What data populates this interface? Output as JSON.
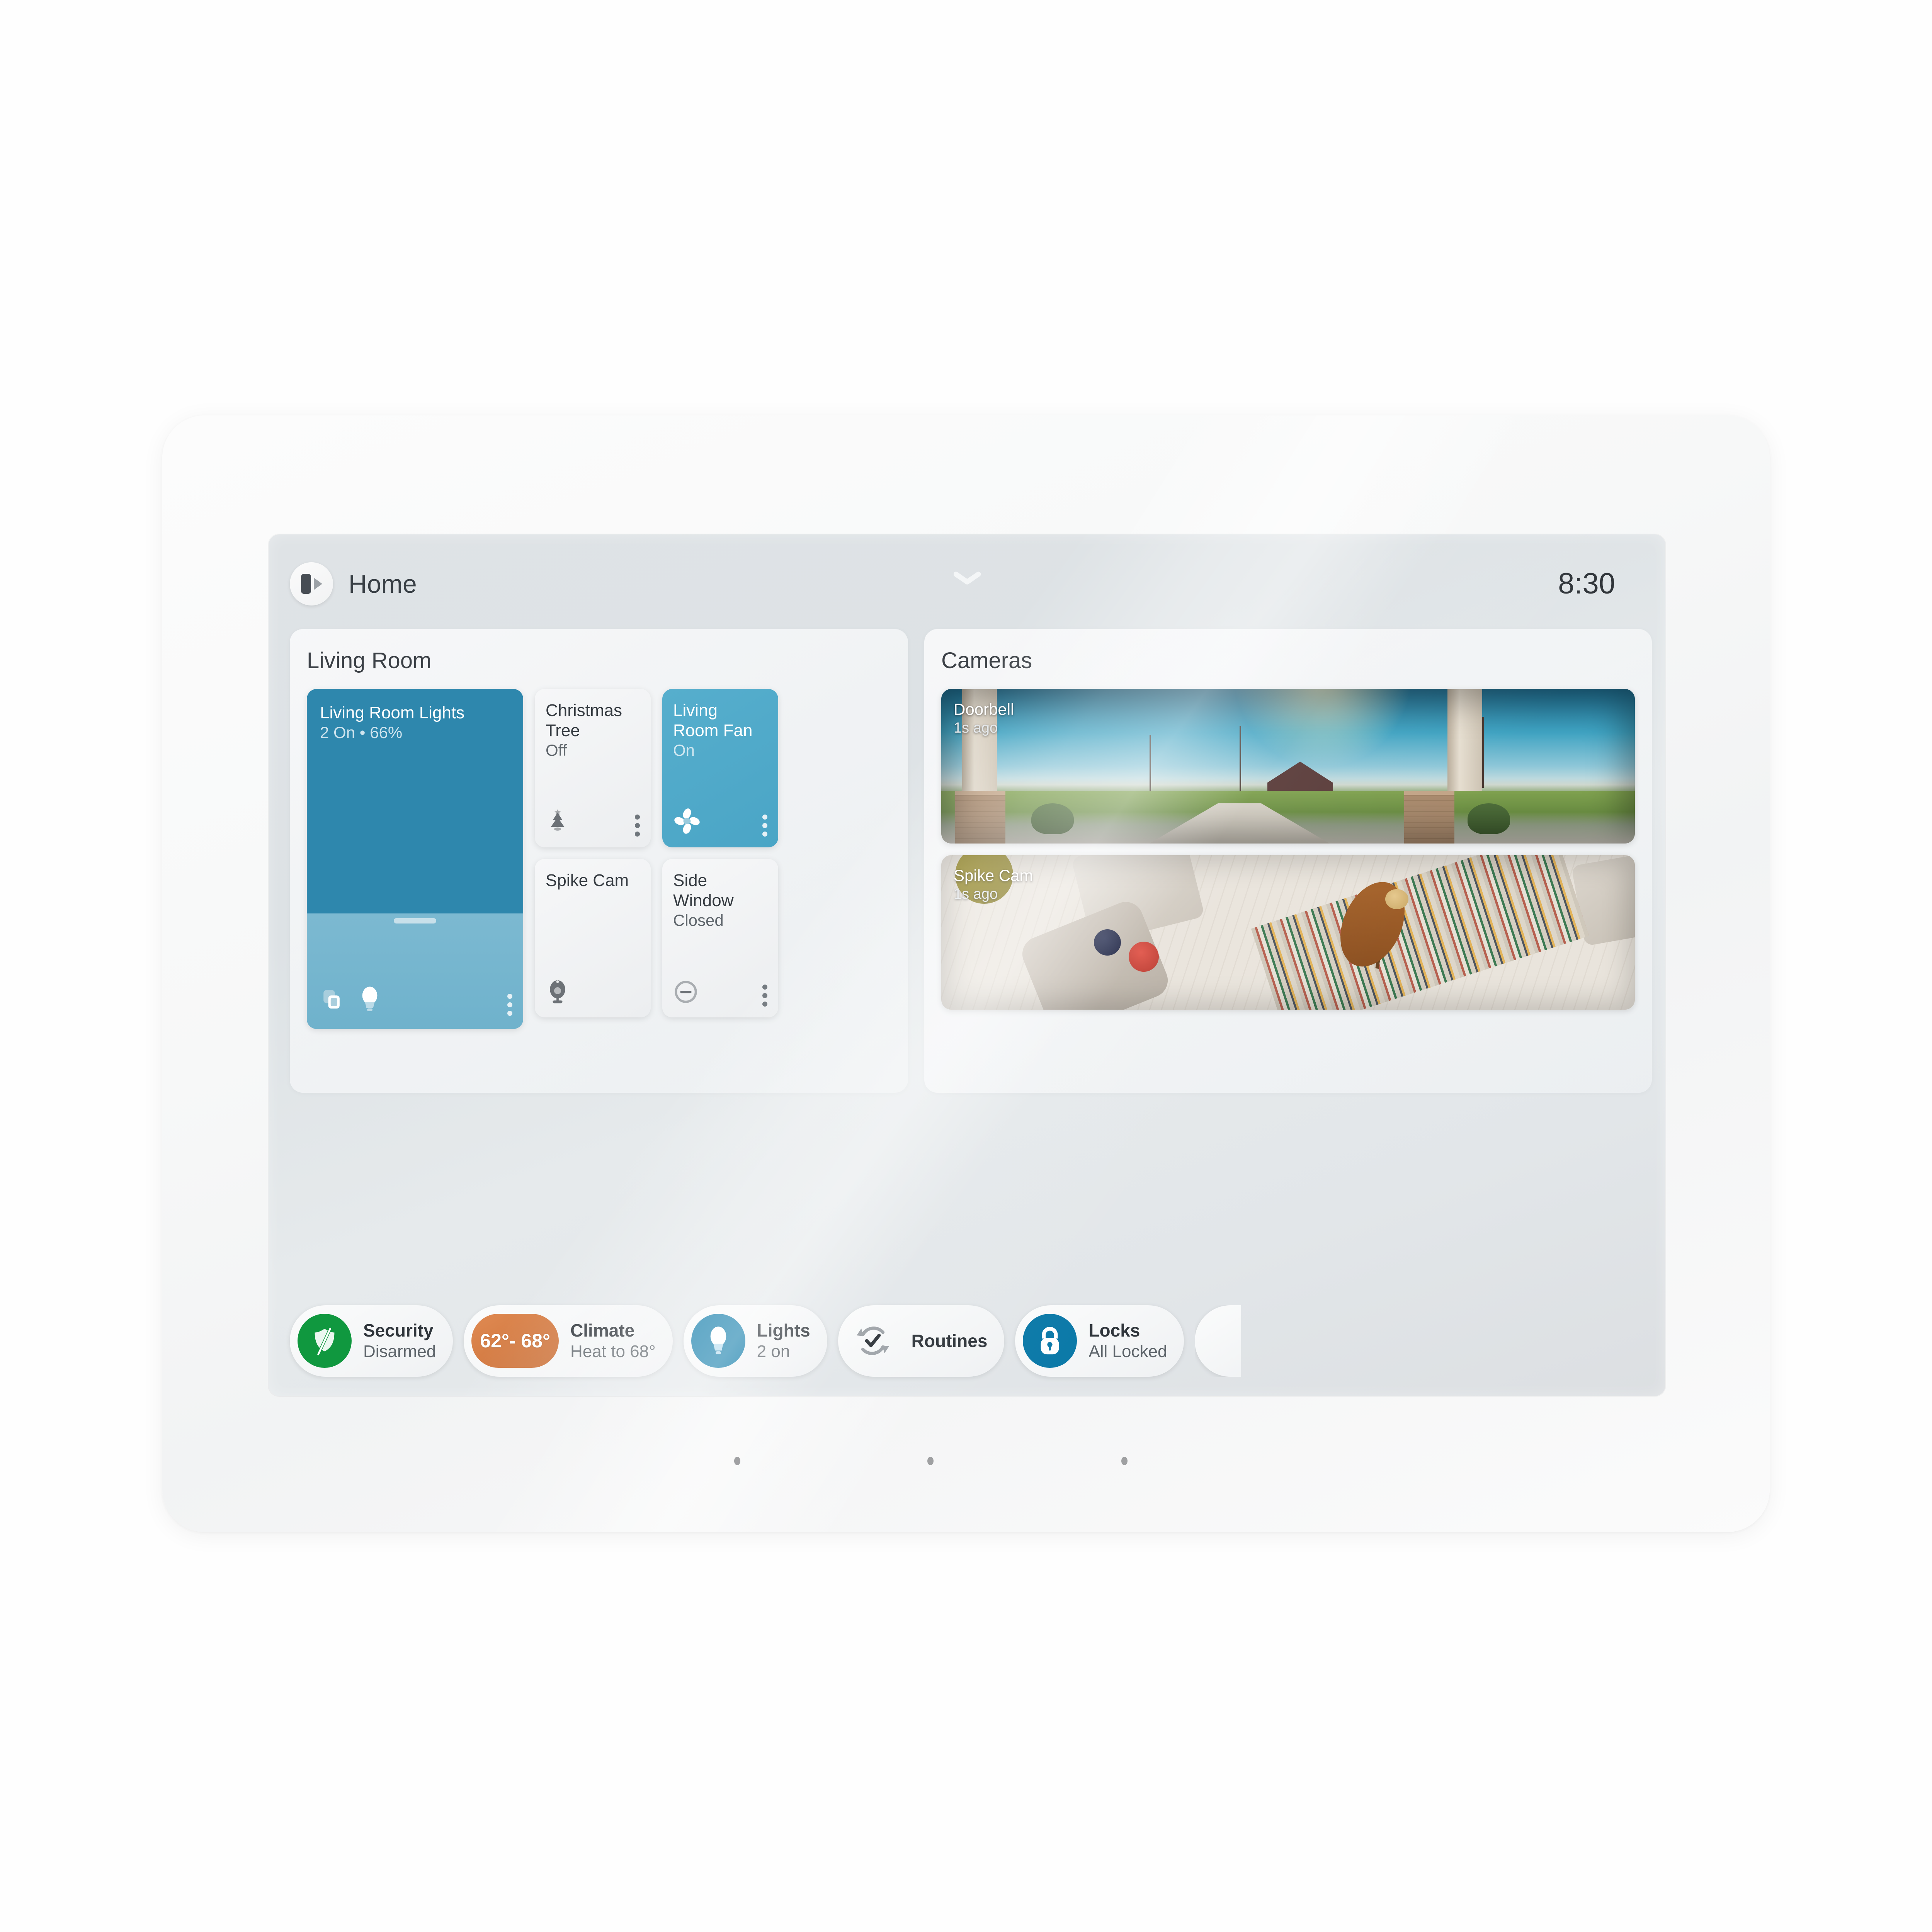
{
  "device": {
    "bezel_camera": "front-camera",
    "bezel_sensor": "ambient-light-sensor",
    "speaker_dots": 3
  },
  "topbar": {
    "avatar_icon": "panel-expand-icon",
    "home_label": "Home",
    "pull_handle_icon": "chevron-down-icon",
    "clock": "8:30"
  },
  "living_room": {
    "title": "Living Room",
    "lights_tile": {
      "name": "Living Room Lights",
      "status": "2 On • 66%",
      "brightness_percent": 66,
      "state": "on",
      "icons": [
        "group-devices-icon",
        "light-bulb-icon"
      ],
      "menu_icon": "more-vertical-icon",
      "accent": "#2e87ad"
    },
    "tiles": [
      {
        "name": "Christmas Tree",
        "status": "Off",
        "state": "off",
        "icon": "christmas-tree-icon",
        "menu_icon": "more-vertical-icon"
      },
      {
        "name": "Living Room Fan",
        "status": "On",
        "state": "on",
        "icon": "fan-icon",
        "menu_icon": "more-vertical-icon",
        "accent": "#4aa5c6"
      },
      {
        "name": "Spike Cam",
        "status": "",
        "state": "off",
        "icon": "webcam-icon",
        "menu_icon": ""
      },
      {
        "name": "Side Window",
        "status": "Closed",
        "state": "off",
        "icon": "contact-sensor-closed-icon",
        "menu_icon": "more-vertical-icon"
      }
    ]
  },
  "cameras": {
    "title": "Cameras",
    "feeds": [
      {
        "name": "Doorbell",
        "time": "1s ago",
        "scene": "outdoor-front-porch"
      },
      {
        "name": "Spike Cam",
        "time": "1s ago",
        "scene": "indoor-living-room"
      }
    ]
  },
  "pills": [
    {
      "label": "Security",
      "value": "Disarmed",
      "icon": "shield-disarmed-icon",
      "icon_bg": "#10983f"
    },
    {
      "label": "Climate",
      "value": "Heat to 68°",
      "icon": "temperature-range-chip",
      "chip_text": "62°- 68°",
      "icon_bg": "#ca7038"
    },
    {
      "label": "Lights",
      "value": "2 on",
      "icon": "light-bulb-icon",
      "icon_bg": "#0b79a8"
    },
    {
      "label": "Routines",
      "value": "",
      "icon": "routines-refresh-check-icon",
      "icon_bg": "transparent"
    },
    {
      "label": "Locks",
      "value": "All Locked",
      "icon": "lock-closed-icon",
      "icon_bg": "#0b79a8"
    }
  ]
}
